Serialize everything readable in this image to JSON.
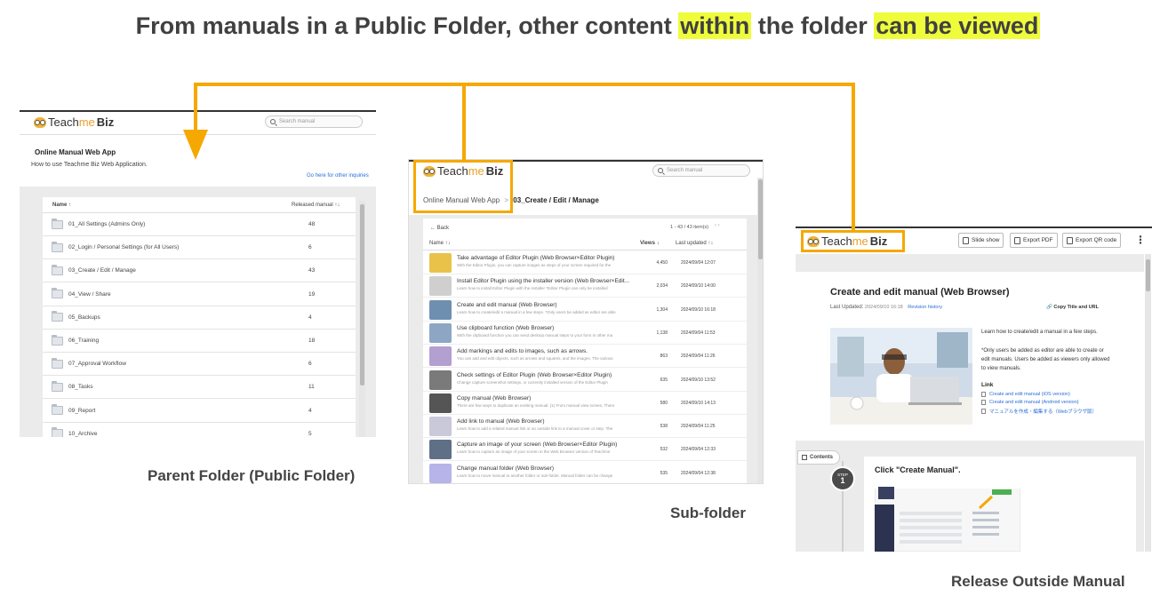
{
  "headline": {
    "part1": "From manuals in a Public Folder, other content ",
    "highlight1": "within",
    "part2": " the folder ",
    "highlight2": "can be viewed"
  },
  "colors": {
    "arrow": "#f5a800",
    "highlight": "#eefc3c"
  },
  "captions": {
    "parent": "Parent Folder (Public Folder)",
    "sub": "Sub-folder",
    "release": "Release Outside Manual"
  },
  "app": {
    "logo_text": "Teach",
    "logo_mid": "me",
    "logo_biz": "Biz",
    "search_placeholder": "Search manual"
  },
  "parent": {
    "title": "Online Manual Web App",
    "description": "How to use Teachme Biz Web Application.",
    "link": "Go here for other inquiries",
    "col_name": "Name ↑",
    "col_count": "Released manual ↑↓",
    "folders": [
      {
        "name": "01_All Settings (Admins Only)",
        "count": "48"
      },
      {
        "name": "02_Login / Personal Settings (for All Users)",
        "count": "6"
      },
      {
        "name": "03_Create / Edit / Manage",
        "count": "43"
      },
      {
        "name": "04_View / Share",
        "count": "19"
      },
      {
        "name": "05_Backups",
        "count": "4"
      },
      {
        "name": "06_Training",
        "count": "18"
      },
      {
        "name": "07_Approval Workflow",
        "count": "6"
      },
      {
        "name": "08_Tasks",
        "count": "11"
      },
      {
        "name": "09_Report",
        "count": "4"
      },
      {
        "name": "10_Archive",
        "count": "5"
      }
    ]
  },
  "sub": {
    "breadcrumb_parent": "Online Manual Web App",
    "breadcrumb_sep": ">",
    "breadcrumb_current": "03_Create / Edit / Manage",
    "back": "Back",
    "pagination": "1 - 43 / 43 item(s)",
    "col_name": "Name ↑↓",
    "col_views": "Views ↓",
    "col_updated": "Last updated ↑↓",
    "manuals": [
      {
        "title": "Take advantage of Editor Plugin (Web Browser×Editor Plugin)",
        "sub": "With the Editor Plugin, you can capture images as steps of your screen required for the",
        "views": "4,450",
        "date": "2024/09/04 12:07",
        "thumb": "#e9c24a"
      },
      {
        "title": "Install Editor Plugin using the installer version (Web Browser×Edit...",
        "sub": "Learn how to install Editor Plugin with the installer *Editor Plugin can only be installed",
        "views": "2,034",
        "date": "2024/09/10 14:00",
        "thumb": "#cfcfcf"
      },
      {
        "title": "Create and edit manual (Web Browser)",
        "sub": "Learn how to create/edit a manual in a few steps. *Only users be added as editor are able",
        "views": "1,304",
        "date": "2024/09/10 16:18",
        "thumb": "#6f8fb0"
      },
      {
        "title": "Use clipboard function (Web Browser)",
        "sub": "With the clipboard function you can send desktop manual steps to your form in other ma",
        "views": "1,138",
        "date": "2024/09/04 11:53",
        "thumb": "#8da6c4"
      },
      {
        "title": "Add markings and edits to images, such as arrows.",
        "sub": "You can add and edit objects, such as arrows and squares, and the images. The various",
        "views": "863",
        "date": "2024/09/04 11:26",
        "thumb": "#b39fd0"
      },
      {
        "title": "Check settings of Editor Plugin (Web Browser×Editor Plugin)",
        "sub": "Change capture screenshot settings, or currently installed version of the Editor Plugin",
        "views": "635",
        "date": "2024/09/10 13:52",
        "thumb": "#7a7a7a"
      },
      {
        "title": "Copy manual (Web Browser)",
        "sub": "There are few ways to duplicate an existing manual. (1) From manual view screen, There",
        "views": "580",
        "date": "2024/09/10 14:13",
        "thumb": "#555555"
      },
      {
        "title": "Add link to manual (Web Browser)",
        "sub": "Learn how to add a related manual link or an outside link to a manual cover or step. *the",
        "views": "538",
        "date": "2024/09/04 11:25",
        "thumb": "#c9c9d9"
      },
      {
        "title": "Capture an image of your screen (Web Browser×Editor Plugin)",
        "sub": "Learn how to capture an image of your screen in the Web Browser version of Teachme",
        "views": "532",
        "date": "2024/09/04 12:33",
        "thumb": "#5f6f86"
      },
      {
        "title": "Change manual folder (Web Browser)",
        "sub": "Learn how to move manual to another folder or sub-folder. Manual folder can be change",
        "views": "535",
        "date": "2024/09/04 12:38",
        "thumb": "#b6b4e8"
      }
    ]
  },
  "release": {
    "btn_slideshow": "Slide show",
    "btn_pdf": "Export PDF",
    "btn_qr": "Export QR code",
    "title": "Create and edit manual (Web Browser)",
    "last_updated_label": "Last Updated:",
    "last_updated_value": "2024/09/10 16:18",
    "revision": "Revision history",
    "copy": "Copy Title and URL",
    "desc1": "Learn how to create/edit a manual in a few steps.",
    "desc2": "*Only users be added as editor are able to create or edit manuals. Users be added as viewers only allowed to view manuals.",
    "link_heading": "Link",
    "links": [
      "Create and edit manual (iOS version)",
      "Create and edit manual (Android version)",
      "マニュアルを作成・編集する（Webブラウザ版）"
    ],
    "contents_tab": "Contents",
    "step_label": "STEP",
    "step_num": "1",
    "step_title": "Click \"Create Manual\"."
  }
}
